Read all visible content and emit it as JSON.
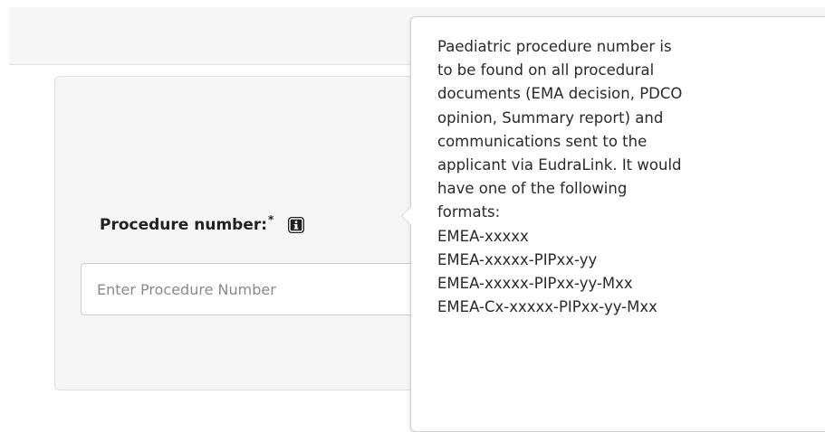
{
  "form": {
    "procedure_label": "Procedure number:",
    "required_marker": "*",
    "procedure_input": {
      "value": "",
      "placeholder": "Enter Procedure Number"
    },
    "info_icon": "info-icon"
  },
  "tooltip": {
    "lines": [
      "Paediatric procedure number is",
      "to be found on all procedural",
      "documents (EMA decision, PDCO",
      "opinion, Summary report) and",
      "communications sent to the",
      "applicant via EudraLink. It would",
      "have one of the following",
      "formats:",
      "EMEA-xxxxx",
      "EMEA-xxxxx-PIPxx-yy",
      "EMEA-xxxxx-PIPxx-yy-Mxx",
      "EMEA-Cx-xxxxx-PIPxx-yy-Mxx"
    ]
  },
  "colors": {
    "panel_background": "#f6f6f6",
    "text": "#222222",
    "icon_fill": "#1f1f1f"
  }
}
